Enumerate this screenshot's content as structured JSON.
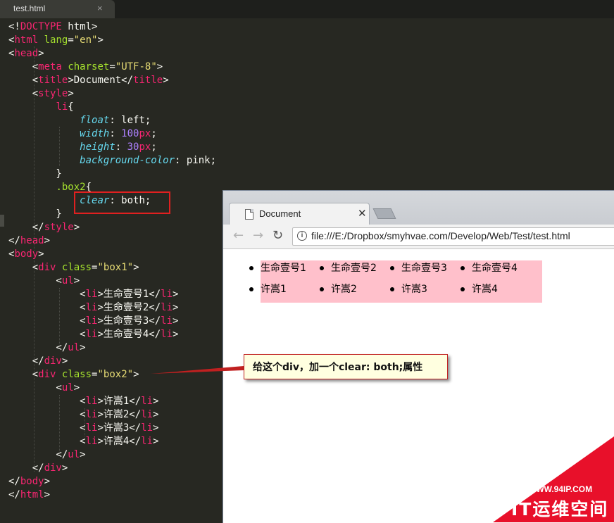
{
  "editor": {
    "tab_name": "test.html",
    "tab_close": "×",
    "lines": [
      [
        [
          "w",
          "<!"
        ],
        [
          "t",
          "DOCTYPE"
        ],
        [
          "w",
          " html>"
        ]
      ],
      [
        [
          "w",
          "<"
        ],
        [
          "t",
          "html"
        ],
        [
          "w",
          " "
        ],
        [
          "a",
          "lang"
        ],
        [
          "w",
          "="
        ],
        [
          "s",
          "\"en\""
        ],
        [
          "w",
          ">"
        ]
      ],
      [
        [
          "w",
          "<"
        ],
        [
          "t",
          "head"
        ],
        [
          "w",
          ">"
        ]
      ],
      [
        [
          "w",
          "    <"
        ],
        [
          "t",
          "meta"
        ],
        [
          "w",
          " "
        ],
        [
          "a",
          "charset"
        ],
        [
          "w",
          "="
        ],
        [
          "s",
          "\"UTF-8\""
        ],
        [
          "w",
          ">"
        ]
      ],
      [
        [
          "w",
          "    <"
        ],
        [
          "t",
          "title"
        ],
        [
          "w",
          ">Document</"
        ],
        [
          "t",
          "title"
        ],
        [
          "w",
          ">"
        ]
      ],
      [
        [
          "w",
          "    <"
        ],
        [
          "t",
          "style"
        ],
        [
          "w",
          ">"
        ]
      ],
      [
        [
          "w",
          "        "
        ],
        [
          "t",
          "li"
        ],
        [
          "w",
          "{"
        ]
      ],
      [
        [
          "w",
          "            "
        ],
        [
          "p",
          "float"
        ],
        [
          "w",
          ": left;"
        ]
      ],
      [
        [
          "w",
          "            "
        ],
        [
          "p",
          "width"
        ],
        [
          "w",
          ": "
        ],
        [
          "n",
          "100"
        ],
        [
          "t",
          "px"
        ],
        [
          "w",
          ";"
        ]
      ],
      [
        [
          "w",
          "            "
        ],
        [
          "p",
          "height"
        ],
        [
          "w",
          ": "
        ],
        [
          "n",
          "30"
        ],
        [
          "t",
          "px"
        ],
        [
          "w",
          ";"
        ]
      ],
      [
        [
          "w",
          "            "
        ],
        [
          "p",
          "background-color"
        ],
        [
          "w",
          ": pink;"
        ]
      ],
      [
        [
          "w",
          "        }"
        ]
      ],
      [
        [
          "w",
          "        "
        ],
        [
          "a",
          ".box2"
        ],
        [
          "w",
          "{"
        ]
      ],
      [
        [
          "w",
          "            "
        ],
        [
          "p",
          "clear"
        ],
        [
          "w",
          ": both;"
        ]
      ],
      [
        [
          "w",
          "        }"
        ]
      ],
      [
        [
          "w",
          "    </"
        ],
        [
          "t",
          "style"
        ],
        [
          "w",
          ">"
        ]
      ],
      [
        [
          "w",
          "</"
        ],
        [
          "t",
          "head"
        ],
        [
          "w",
          ">"
        ]
      ],
      [
        [
          "w",
          "<"
        ],
        [
          "t",
          "body"
        ],
        [
          "w",
          ">"
        ]
      ],
      [
        [
          "w",
          "    <"
        ],
        [
          "t",
          "div"
        ],
        [
          "w",
          " "
        ],
        [
          "a",
          "class"
        ],
        [
          "w",
          "="
        ],
        [
          "s",
          "\"box1\""
        ],
        [
          "w",
          ">"
        ]
      ],
      [
        [
          "w",
          "        <"
        ],
        [
          "t",
          "ul"
        ],
        [
          "w",
          ">"
        ]
      ],
      [
        [
          "w",
          "            <"
        ],
        [
          "t",
          "li"
        ],
        [
          "w",
          ">生命壹号1</"
        ],
        [
          "t",
          "li"
        ],
        [
          "w",
          ">"
        ]
      ],
      [
        [
          "w",
          "            <"
        ],
        [
          "t",
          "li"
        ],
        [
          "w",
          ">生命壹号2</"
        ],
        [
          "t",
          "li"
        ],
        [
          "w",
          ">"
        ]
      ],
      [
        [
          "w",
          "            <"
        ],
        [
          "t",
          "li"
        ],
        [
          "w",
          ">生命壹号3</"
        ],
        [
          "t",
          "li"
        ],
        [
          "w",
          ">"
        ]
      ],
      [
        [
          "w",
          "            <"
        ],
        [
          "t",
          "li"
        ],
        [
          "w",
          ">生命壹号4</"
        ],
        [
          "t",
          "li"
        ],
        [
          "w",
          ">"
        ]
      ],
      [
        [
          "w",
          "        </"
        ],
        [
          "t",
          "ul"
        ],
        [
          "w",
          ">"
        ]
      ],
      [
        [
          "w",
          "    </"
        ],
        [
          "t",
          "div"
        ],
        [
          "w",
          ">"
        ]
      ],
      [
        [
          "w",
          "    <"
        ],
        [
          "t",
          "div"
        ],
        [
          "w",
          " "
        ],
        [
          "a",
          "class"
        ],
        [
          "w",
          "="
        ],
        [
          "s",
          "\"box2\""
        ],
        [
          "w",
          ">"
        ]
      ],
      [
        [
          "w",
          "        <"
        ],
        [
          "t",
          "ul"
        ],
        [
          "w",
          ">"
        ]
      ],
      [
        [
          "w",
          "            <"
        ],
        [
          "t",
          "li"
        ],
        [
          "w",
          ">许嵩1</"
        ],
        [
          "t",
          "li"
        ],
        [
          "w",
          ">"
        ]
      ],
      [
        [
          "w",
          "            <"
        ],
        [
          "t",
          "li"
        ],
        [
          "w",
          ">许嵩2</"
        ],
        [
          "t",
          "li"
        ],
        [
          "w",
          ">"
        ]
      ],
      [
        [
          "w",
          "            <"
        ],
        [
          "t",
          "li"
        ],
        [
          "w",
          ">许嵩3</"
        ],
        [
          "t",
          "li"
        ],
        [
          "w",
          ">"
        ]
      ],
      [
        [
          "w",
          "            <"
        ],
        [
          "t",
          "li"
        ],
        [
          "w",
          ">许嵩4</"
        ],
        [
          "t",
          "li"
        ],
        [
          "w",
          ">"
        ]
      ],
      [
        [
          "w",
          "        </"
        ],
        [
          "t",
          "ul"
        ],
        [
          "w",
          ">"
        ]
      ],
      [
        [
          "w",
          "    </"
        ],
        [
          "t",
          "div"
        ],
        [
          "w",
          ">"
        ]
      ],
      [
        [
          "w",
          "</"
        ],
        [
          "t",
          "body"
        ],
        [
          "w",
          ">"
        ]
      ],
      [
        [
          "w",
          "</"
        ],
        [
          "t",
          "html"
        ],
        [
          "w",
          ">"
        ]
      ]
    ],
    "colors": {
      "tag": "#f92672",
      "attr": "#a6e22e",
      "string": "#e6db74",
      "property": "#66d9ef",
      "number": "#ae81ff",
      "text": "#f8f8f2",
      "background": "#272822"
    }
  },
  "browser": {
    "tab_title": "Document",
    "tab_close": "✕",
    "back_icon": "←",
    "forward_icon": "→",
    "reload_icon": "↻",
    "info_icon": "i",
    "url": "file:///E:/Dropbox/smyhvae.com/Develop/Web/Test/test.html",
    "box1_items": [
      "生命壹号1",
      "生命壹号2",
      "生命壹号3",
      "生命壹号4"
    ],
    "box2_items": [
      "许嵩1",
      "许嵩2",
      "许嵩3",
      "许嵩4"
    ],
    "list_background": "pink"
  },
  "callout": {
    "text": "给这个div，加一个clear: both;属性",
    "border_color": "#c02020",
    "background": "#ffffe0"
  },
  "watermark": {
    "url": "WWW.94IP.COM",
    "name": "IT运维空间",
    "color": "#e8102a"
  }
}
